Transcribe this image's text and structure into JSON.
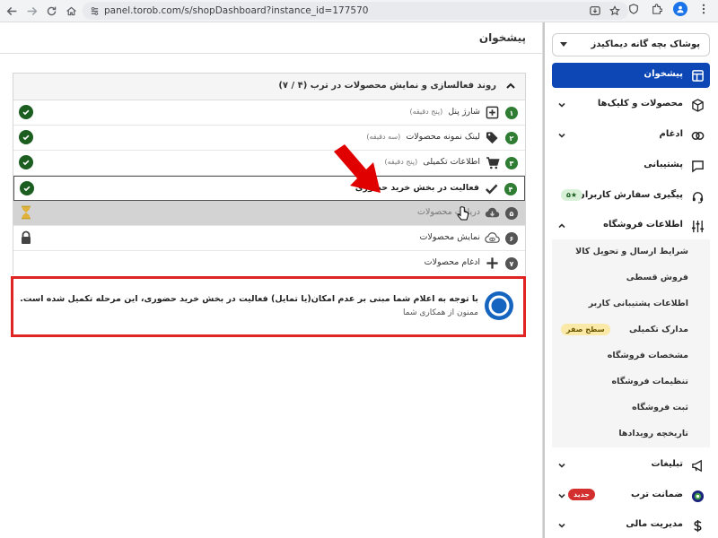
{
  "browser": {
    "url": "panel.torob.com/s/shopDashboard?instance_id=177570"
  },
  "main": {
    "page_title": "پیشخوان",
    "panel": {
      "title": "روند فعالسازی و نمایش محصولات در ترب (۴ / ۷)",
      "steps": [
        {
          "num": "۱",
          "label": "شارژ پنل",
          "hint": "(پنج دقیقه)",
          "icon": "plus-box-icon",
          "state": "done"
        },
        {
          "num": "۲",
          "label": "لینک نمونه محصولات",
          "hint": "(سه دقیقه)",
          "icon": "tag-icon",
          "state": "done"
        },
        {
          "num": "۳",
          "label": "اطلاعات تکمیلی",
          "hint": "(پنج دقیقه)",
          "icon": "cart-icon",
          "state": "done"
        },
        {
          "num": "۴",
          "label": "فعالیت در بخش خرید حضوری",
          "hint": "",
          "icon": "check-icon",
          "state": "done-active"
        },
        {
          "num": "۵",
          "label": "دریافت محصولات",
          "hint": "",
          "icon": "cloud-download-icon",
          "state": "pending"
        },
        {
          "num": "۶",
          "label": "نمایش محصولات",
          "hint": "",
          "icon": "eye-cloud-icon",
          "state": "locked"
        },
        {
          "num": "۷",
          "label": "ادغام محصولات",
          "hint": "",
          "icon": "plus-icon",
          "state": "none"
        }
      ]
    },
    "notice": {
      "text": "با توجه به اعلام شما مبنی بر عدم امکان(یا تمایل) فعالیت در بخش خرید حضوری، این مرحله تکمیل شده است.",
      "sub": "ممنون از همکاری شما"
    }
  },
  "sidebar": {
    "shop_name": "پوشاک بچه گانه دیماکیدز",
    "items": [
      {
        "label": "پیشخوان",
        "icon": "dashboard-icon",
        "active": true
      },
      {
        "label": "محصولات و کلیک‌ها",
        "icon": "cube-icon",
        "chevron": true
      },
      {
        "label": "ادغام",
        "icon": "merge-icon",
        "chevron": true
      },
      {
        "label": "پشتیبانی",
        "icon": "chat-icon"
      },
      {
        "label": "پیگیری سفارش کاربران",
        "icon": "headset-icon",
        "badge": "۵★"
      },
      {
        "label": "اطلاعات فروشگاه",
        "icon": "sliders-icon",
        "chevron": true,
        "expanded": true
      }
    ],
    "sub_items": [
      {
        "label": "شرایط ارسال و تحویل کالا"
      },
      {
        "label": "فروش قسطی"
      },
      {
        "label": "اطلاعات پشتیبانی کاربر"
      },
      {
        "label": "مدارک تکمیلی",
        "badge": "سطح صفر"
      },
      {
        "label": "مشخصات فروشگاه"
      },
      {
        "label": "تنظیمات فروشگاه"
      },
      {
        "label": "ثبت فروشگاه"
      },
      {
        "label": "تاریخچه رویدادها"
      }
    ],
    "bottom_items": [
      {
        "label": "تبلیغات",
        "icon": "megaphone-icon",
        "chevron": true
      },
      {
        "label": "ضمانت ترب",
        "icon": "shield-badge-icon",
        "chevron": true,
        "badge": "جدید"
      },
      {
        "label": "مدیریت مالی",
        "icon": "dollar-icon",
        "chevron": true
      }
    ]
  },
  "colors": {
    "primary": "#0d47b5",
    "success": "#1b5e20",
    "alert_border": "#e02424",
    "pending": "#d3d3d3"
  }
}
